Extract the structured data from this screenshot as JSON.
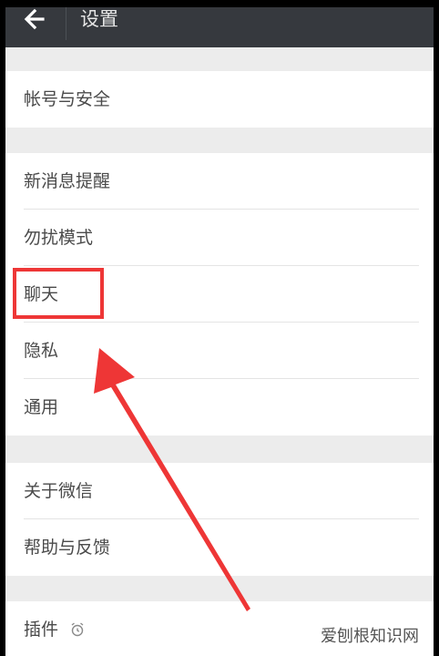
{
  "header": {
    "title": "设置",
    "back_icon": "arrow-left-icon"
  },
  "groups": [
    {
      "items": [
        {
          "label": "帐号与安全"
        }
      ]
    },
    {
      "items": [
        {
          "label": "新消息提醒"
        },
        {
          "label": "勿扰模式"
        },
        {
          "label": "聊天"
        },
        {
          "label": "隐私"
        },
        {
          "label": "通用"
        }
      ]
    },
    {
      "items": [
        {
          "label": "关于微信"
        },
        {
          "label": "帮助与反馈"
        }
      ]
    },
    {
      "items": [
        {
          "label": "插件",
          "icon": "plugin-icon"
        }
      ]
    }
  ],
  "annotation": {
    "color": "#ee3636",
    "highlighted_item": "聊天"
  },
  "watermark": "爱刨根知识网"
}
